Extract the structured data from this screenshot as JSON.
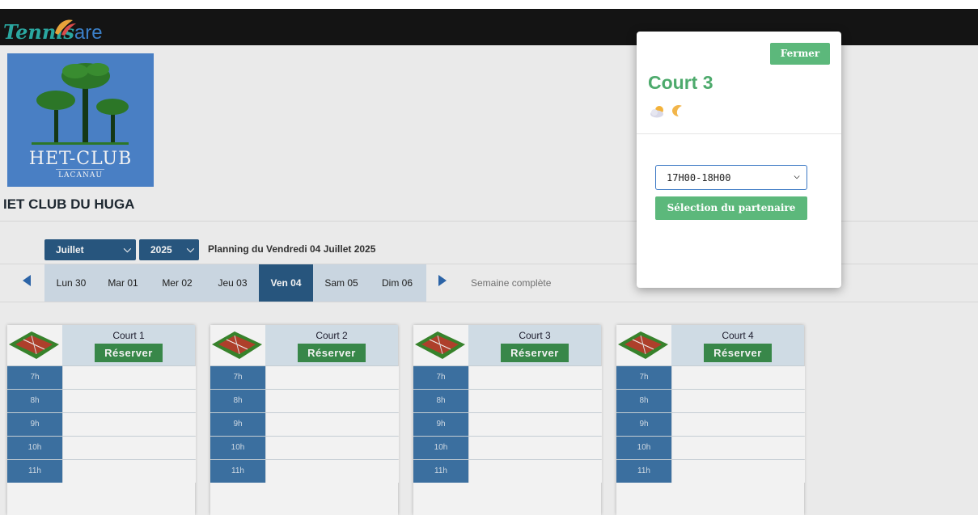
{
  "header": {
    "brand_part1": "Tennis",
    "brand_part2": "are"
  },
  "club": {
    "logo_title": "HET-CLUB",
    "logo_subtitle": "LACANAU",
    "name": "IET CLUB DU HUGA"
  },
  "planning": {
    "month": "Juillet",
    "year": "2025",
    "title": "Planning du Vendredi 04 Juillet 2025",
    "days": [
      {
        "label": "Lun 30"
      },
      {
        "label": "Mar 01"
      },
      {
        "label": "Mer 02"
      },
      {
        "label": "Jeu 03"
      },
      {
        "label": "Ven 04"
      },
      {
        "label": "Sam 05"
      },
      {
        "label": "Dim 06"
      }
    ],
    "active_day": "Ven 04",
    "week_link": "Semaine complète"
  },
  "courts": [
    {
      "name": "Court 1",
      "reserve": "Réserver"
    },
    {
      "name": "Court 2",
      "reserve": "Réserver"
    },
    {
      "name": "Court 3",
      "reserve": "Réserver"
    },
    {
      "name": "Court 4",
      "reserve": "Réserver"
    }
  ],
  "hours": [
    "7h",
    "8h",
    "9h",
    "10h",
    "11h"
  ],
  "modal": {
    "close_label": "Fermer",
    "title": "Court 3",
    "weather_icons": [
      "cloud-sun-icon",
      "moon-icon"
    ],
    "selected_slot": "17H00-18H00",
    "partner_button": "Sélection du partenaire"
  },
  "colors": {
    "accent_green": "#5cb87b",
    "navy": "#2a5a84",
    "logo_blue": "#4d86cf"
  }
}
